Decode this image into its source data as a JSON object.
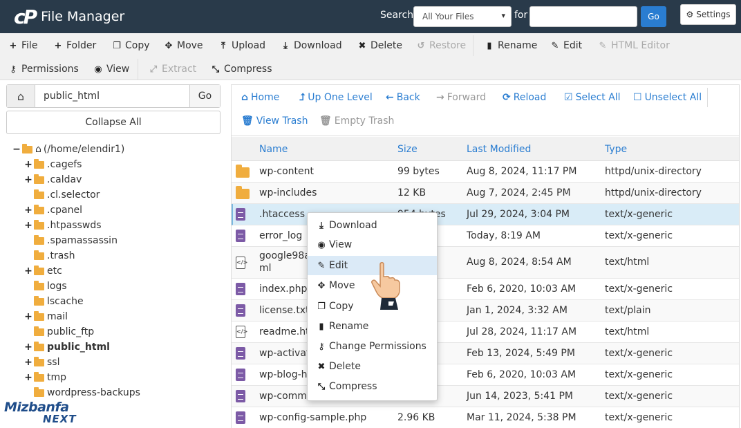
{
  "header": {
    "logo_mark": "cP",
    "title": "File Manager",
    "search_label": "Search",
    "search_scope": "All Your Files",
    "for_label": "for",
    "search_value": "",
    "go_label": "Go",
    "settings_label": "Settings"
  },
  "toolbar": {
    "row1": [
      {
        "label": "File",
        "icon": "plus-icon"
      },
      {
        "label": "Folder",
        "icon": "plus-icon"
      },
      {
        "label": "Copy",
        "icon": "copy-icon"
      },
      {
        "label": "Move",
        "icon": "move-icon"
      },
      {
        "label": "Upload",
        "icon": "upload-icon"
      },
      {
        "label": "Download",
        "icon": "download-icon"
      },
      {
        "label": "Delete",
        "icon": "close-icon"
      },
      {
        "label": "Restore",
        "icon": "restore-icon"
      },
      {
        "label": "Rename",
        "icon": "file-icon"
      },
      {
        "label": "Edit",
        "icon": "pencil-icon"
      },
      {
        "label": "HTML Editor",
        "icon": "edit-icon"
      }
    ],
    "row2": [
      {
        "label": "Permissions",
        "icon": "key-icon"
      },
      {
        "label": "View",
        "icon": "eye-icon"
      },
      {
        "label": "Extract",
        "icon": "expand-icon"
      },
      {
        "label": "Compress",
        "icon": "compress-icon"
      }
    ]
  },
  "left": {
    "path_value": "public_html",
    "go_label": "Go",
    "collapse_label": "Collapse All",
    "tree": [
      {
        "label": "(/home/elendir1)",
        "toggle": "−",
        "level": 0
      },
      {
        "label": ".cagefs",
        "toggle": "+",
        "level": 1
      },
      {
        "label": ".caldav",
        "toggle": "+",
        "level": 1
      },
      {
        "label": ".cl.selector",
        "toggle": "",
        "level": 1
      },
      {
        "label": ".cpanel",
        "toggle": "+",
        "level": 1
      },
      {
        "label": ".htpasswds",
        "toggle": "+",
        "level": 1
      },
      {
        "label": ".spamassassin",
        "toggle": "",
        "level": 1
      },
      {
        "label": ".trash",
        "toggle": "",
        "level": 1
      },
      {
        "label": "etc",
        "toggle": "+",
        "level": 1
      },
      {
        "label": "logs",
        "toggle": "",
        "level": 1
      },
      {
        "label": "lscache",
        "toggle": "",
        "level": 1
      },
      {
        "label": "mail",
        "toggle": "+",
        "level": 1
      },
      {
        "label": "public_ftp",
        "toggle": "",
        "level": 1
      },
      {
        "label": "public_html",
        "toggle": "+",
        "level": 1
      },
      {
        "label": "ssl",
        "toggle": "+",
        "level": 1
      },
      {
        "label": "tmp",
        "toggle": "+",
        "level": 1
      },
      {
        "label": "wordpress-backups",
        "toggle": "",
        "level": 1
      }
    ],
    "brand_top": "Mizbanfa",
    "brand_bottom": "NEXT"
  },
  "nav": {
    "row1": [
      {
        "label": "Home",
        "icon": "home-icon"
      },
      {
        "label": "Up One Level",
        "icon": "level-up-icon"
      },
      {
        "label": "Back",
        "icon": "arrow-left-icon"
      },
      {
        "label": "Forward",
        "icon": "arrow-right-icon"
      },
      {
        "label": "Reload",
        "icon": "reload-icon"
      },
      {
        "label": "Select All",
        "icon": "checkbox-checked-icon"
      },
      {
        "label": "Unselect All",
        "icon": "checkbox-icon"
      }
    ],
    "row2": [
      {
        "label": "View Trash",
        "icon": "trash-icon"
      },
      {
        "label": "Empty Trash",
        "icon": "trash-icon"
      }
    ]
  },
  "files": {
    "columns": [
      "Name",
      "Size",
      "Last Modified",
      "Type"
    ],
    "rows": [
      {
        "name": "wp-content",
        "size": "99 bytes",
        "modified": "Aug 8, 2024, 11:17 PM",
        "type": "httpd/unix-directory",
        "icon": "folder"
      },
      {
        "name": "wp-includes",
        "size": "12 KB",
        "modified": "Aug 7, 2024, 2:45 PM",
        "type": "httpd/unix-directory",
        "icon": "folder"
      },
      {
        "name": ".htaccess",
        "size": "954 bytes",
        "modified": "Jul 29, 2024, 3:04 PM",
        "type": "text/x-generic",
        "icon": "file"
      },
      {
        "name": "error_log",
        "size": "",
        "modified": "Today, 8:19 AM",
        "type": "text/x-generic",
        "icon": "file"
      },
      {
        "name": "google98a7",
        "name2": "ml",
        "size": "",
        "modified": "Aug 8, 2024, 8:54 AM",
        "type": "text/html",
        "icon": "html"
      },
      {
        "name": "index.php",
        "size": "",
        "modified": "Feb 6, 2020, 10:03 AM",
        "type": "text/x-generic",
        "icon": "file"
      },
      {
        "name": "license.txt",
        "size": "",
        "modified": "Jan 1, 2024, 3:32 AM",
        "type": "text/plain",
        "icon": "file"
      },
      {
        "name": "readme.htm",
        "size": "",
        "modified": "Jul 28, 2024, 11:17 AM",
        "type": "text/html",
        "icon": "html"
      },
      {
        "name": "wp-activate",
        "size": "",
        "modified": "Feb 13, 2024, 5:49 PM",
        "type": "text/x-generic",
        "icon": "file"
      },
      {
        "name": "wp-blog-he",
        "size": "",
        "modified": "Feb 6, 2020, 10:03 AM",
        "type": "text/x-generic",
        "icon": "file"
      },
      {
        "name": "wp-comme",
        "size": "",
        "modified": "Jun 14, 2023, 5:41 PM",
        "type": "text/x-generic",
        "icon": "file"
      },
      {
        "name": "wp-config-sample.php",
        "size": "2.96 KB",
        "modified": "Mar 11, 2024, 5:38 PM",
        "type": "text/x-generic",
        "icon": "file"
      }
    ]
  },
  "context_menu": {
    "items": [
      {
        "label": "Download",
        "icon": "download-icon"
      },
      {
        "label": "View",
        "icon": "eye-icon"
      },
      {
        "label": "Edit",
        "icon": "pencil-icon"
      },
      {
        "label": "Move",
        "icon": "move-icon"
      },
      {
        "label": "Copy",
        "icon": "copy-icon"
      },
      {
        "label": "Rename",
        "icon": "file-icon"
      },
      {
        "label": "Change Permissions",
        "icon": "key-icon"
      },
      {
        "label": "Delete",
        "icon": "close-icon"
      },
      {
        "label": "Compress",
        "icon": "compress-icon"
      }
    ],
    "active": "Edit"
  },
  "colors": {
    "header_bg": "#293a4a",
    "link_blue": "#2a7dd1",
    "folder": "#f0ad3e",
    "file_icon": "#7c5aa6",
    "selected_row": "#d9ecf7"
  }
}
